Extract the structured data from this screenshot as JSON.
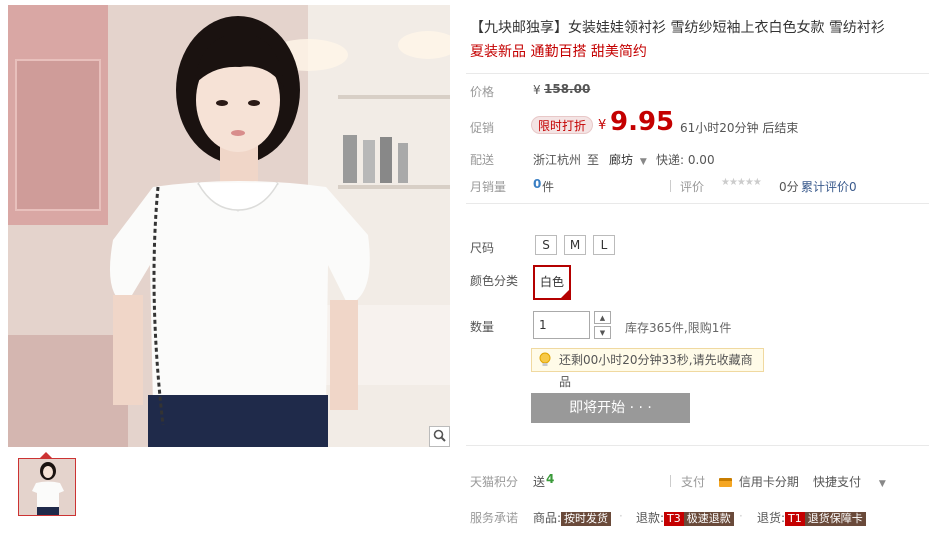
{
  "title": {
    "main": "【九块邮独享】女装娃娃领衬衫 雪纺纱短袖上衣白色女款 雪纺衬衫",
    "sub": "夏装新品 通勤百搭 甜美简约"
  },
  "price": {
    "label": "价格",
    "currency": "¥",
    "original": "158.00"
  },
  "promo": {
    "label": "促销",
    "tag": "限时打折",
    "currency": "¥",
    "price": "9.95",
    "countdown": "61小时20分钟 后结束"
  },
  "shipping": {
    "label": "配送",
    "from": "浙江杭州",
    "to_word": "至",
    "to": "廊坊",
    "fee": "快递: 0.00"
  },
  "sales": {
    "label": "月销量",
    "count": "0",
    "unit": "件",
    "rating_label": "评价",
    "rating_score": "0分",
    "rating_stars": 0,
    "total_reviews": "累计评价0"
  },
  "size": {
    "label": "尺码",
    "options": [
      "S",
      "M",
      "L"
    ]
  },
  "color": {
    "label": "颜色分类",
    "selected": "白色"
  },
  "quantity": {
    "label": "数量",
    "value": "1",
    "stock": "库存365件,限购1件"
  },
  "tip": "还剩00小时20分钟33秒,请先收藏商品",
  "cta": "即将开始 · · ·",
  "points": {
    "label": "天猫积分",
    "text": "送",
    "value": "4",
    "pay_label": "支付",
    "credit": "信用卡分期",
    "quick_pay": "快捷支付"
  },
  "service": {
    "label": "服务承诺",
    "goods_label": "商品:",
    "goods_badge": "按时发货",
    "refund_label": "退款:",
    "refund_code": "T3",
    "refund_badge": "极速退款",
    "return_label": "退货:",
    "return_code": "T1",
    "return_badge": "退货保障卡"
  },
  "colors": {
    "accent": "#c40000",
    "cta_disabled": "#999999",
    "muted": "#999999"
  }
}
